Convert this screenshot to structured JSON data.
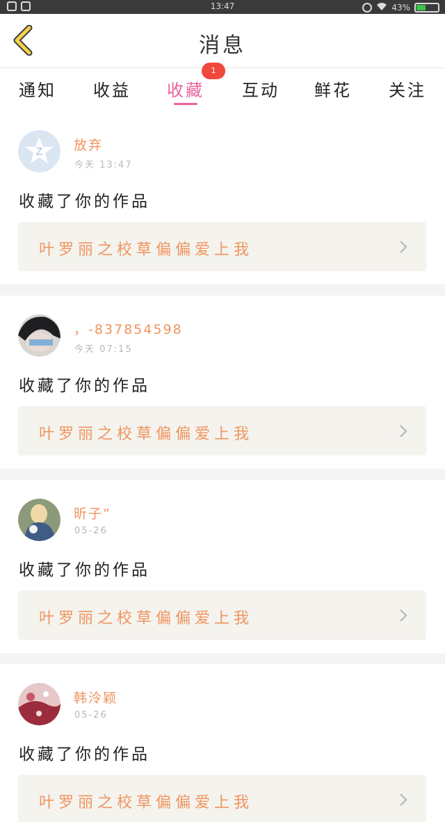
{
  "status_bar": {
    "time": "13:47",
    "battery_text": "43%",
    "battery_level": 0.43,
    "icons": [
      "notification-icon",
      "image-icon",
      "sync-icon",
      "wifi-icon",
      "battery-icon"
    ]
  },
  "header": {
    "title": "消息",
    "back_icon": "chevron-left-icon"
  },
  "colors": {
    "accent_pink": "#e8629b",
    "accent_orange": "#f0945f",
    "badge_red": "#f0473f",
    "link_bg": "#f4f3ee"
  },
  "tabs": [
    {
      "label": "通知",
      "active": false
    },
    {
      "label": "收益",
      "active": false
    },
    {
      "label": "收藏",
      "active": true,
      "badge": "1"
    },
    {
      "label": "互动",
      "active": false
    },
    {
      "label": "鲜花",
      "active": false
    },
    {
      "label": "关注",
      "active": false
    }
  ],
  "messages": [
    {
      "user": "放弃",
      "time": "今天 13:47",
      "action": "收藏了你的作品",
      "work_title": "叶罗丽之校草偏偏爱上我",
      "avatar_icon": "default-avatar-icon"
    },
    {
      "user": "，-837854598",
      "time": "今天 07:15",
      "action": "收藏了你的作品",
      "work_title": "叶罗丽之校草偏偏爱上我",
      "avatar_icon": "user-avatar"
    },
    {
      "user": "昕子”",
      "time": "05-26",
      "action": "收藏了你的作品",
      "work_title": "叶罗丽之校草偏偏爱上我",
      "avatar_icon": "user-avatar"
    },
    {
      "user": "韩泠颖",
      "time": "05-26",
      "action": "收藏了你的作品",
      "work_title": "叶罗丽之校草偏偏爱上我",
      "avatar_icon": "user-avatar"
    }
  ]
}
